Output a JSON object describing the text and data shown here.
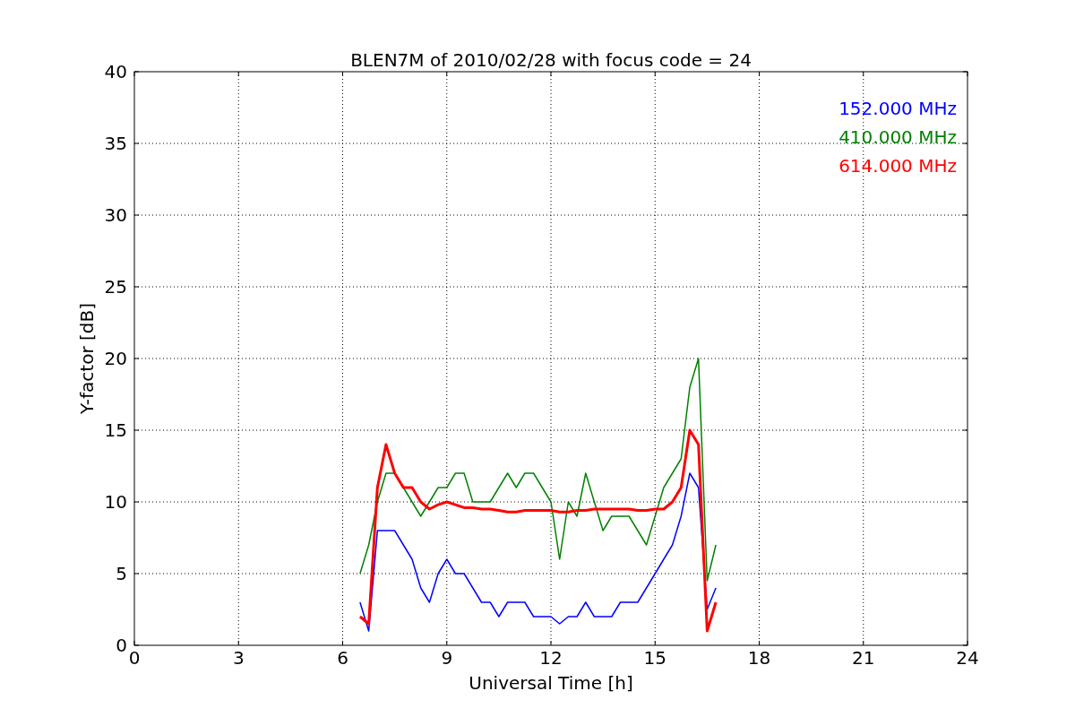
{
  "chart_data": {
    "type": "line",
    "title": "BLEN7M of 2010/02/28 with focus code = 24",
    "xlabel": "Universal Time [h]",
    "ylabel": "Y-factor [dB]",
    "x": [
      6.5,
      6.75,
      7,
      7.25,
      7.5,
      7.75,
      8,
      8.25,
      8.5,
      8.75,
      9,
      9.25,
      9.5,
      9.75,
      10,
      10.25,
      10.5,
      10.75,
      11,
      11.25,
      11.5,
      11.75,
      12,
      12.25,
      12.5,
      12.75,
      13,
      13.25,
      13.5,
      13.75,
      14,
      14.25,
      14.5,
      14.75,
      15,
      15.25,
      15.5,
      15.75,
      16,
      16.25,
      16.5,
      16.75
    ],
    "series": [
      {
        "name": "152.000 MHz",
        "color": "#0000ff",
        "values": [
          3,
          1,
          8,
          8,
          8,
          7,
          6,
          4,
          3,
          5,
          6,
          5,
          5,
          4,
          3,
          3,
          2,
          3,
          3,
          3,
          2,
          2,
          2,
          1.5,
          2,
          2,
          3,
          2,
          2,
          2,
          3,
          3,
          3,
          4,
          5,
          6,
          7,
          9,
          12,
          11,
          2.5,
          4
        ]
      },
      {
        "name": "410.000 MHz",
        "color": "#008000",
        "values": [
          5,
          7,
          10,
          12,
          12,
          11,
          10,
          9,
          10,
          11,
          11,
          12,
          12,
          10,
          10,
          10,
          11,
          12,
          11,
          12,
          12,
          11,
          10,
          6,
          10,
          9,
          12,
          10,
          8,
          9,
          9,
          9,
          8,
          7,
          9,
          11,
          12,
          13,
          18,
          20,
          4.5,
          7
        ]
      },
      {
        "name": "614.000 MHz",
        "color": "#ff0000",
        "values": [
          2,
          1.5,
          11,
          14,
          12,
          11,
          11,
          10,
          9.5,
          9.8,
          10,
          9.8,
          9.6,
          9.6,
          9.5,
          9.5,
          9.4,
          9.3,
          9.3,
          9.4,
          9.4,
          9.4,
          9.4,
          9.3,
          9.3,
          9.4,
          9.4,
          9.5,
          9.5,
          9.5,
          9.5,
          9.5,
          9.4,
          9.4,
          9.5,
          9.5,
          10,
          11,
          15,
          14,
          1,
          3
        ]
      }
    ],
    "xlim": [
      0,
      24
    ],
    "ylim": [
      0,
      40
    ],
    "xticks": [
      0,
      3,
      6,
      9,
      12,
      15,
      18,
      21,
      24
    ],
    "yticks": [
      0,
      5,
      10,
      15,
      20,
      25,
      30,
      35,
      40
    ],
    "grid": true
  }
}
